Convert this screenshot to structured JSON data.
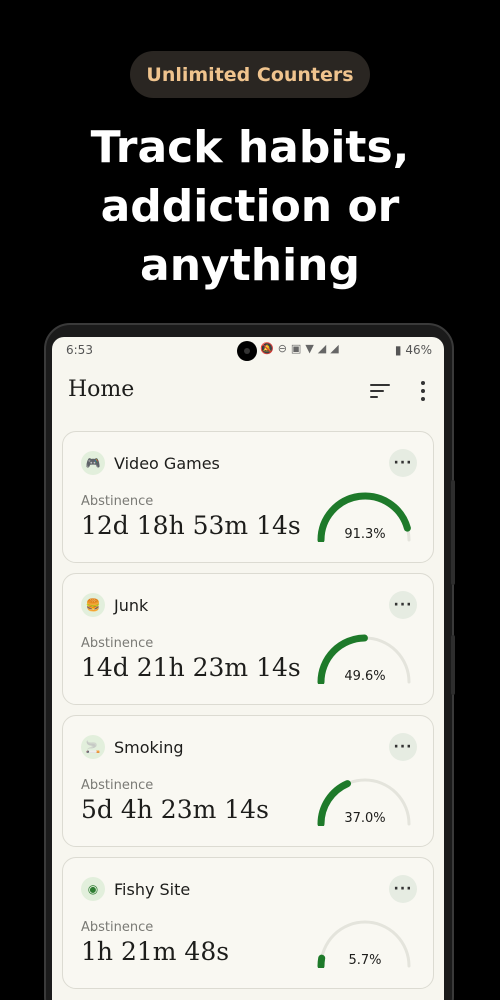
{
  "promo": {
    "badge": "Unlimited Counters",
    "headline_lines": [
      "Track habits,",
      "addiction or",
      "anything"
    ]
  },
  "status_bar": {
    "time": "6:53",
    "battery": "46%"
  },
  "app": {
    "title": "Home"
  },
  "counters": [
    {
      "name": "Video Games",
      "icon": "gamepad-icon",
      "icon_glyph": "🎮",
      "label": "Abstinence",
      "timer": "12d 18h 53m 14s",
      "percent": 91.3,
      "percent_text": "91.3%"
    },
    {
      "name": "Junk",
      "icon": "fast-food-icon",
      "icon_glyph": "🍔",
      "label": "Abstinence",
      "timer": "14d 21h 23m 14s",
      "percent": 49.6,
      "percent_text": "49.6%"
    },
    {
      "name": "Smoking",
      "icon": "cigarette-icon",
      "icon_glyph": "🚬",
      "label": "Abstinence",
      "timer": "5d 4h 23m 14s",
      "percent": 37.0,
      "percent_text": "37.0%"
    },
    {
      "name": "Fishy Site",
      "icon": "eye-icon",
      "icon_glyph": "◉",
      "label": "Abstinence",
      "timer": "1h 21m 48s",
      "percent": 5.7,
      "percent_text": "5.7%"
    }
  ],
  "colors": {
    "accent": "#1e7a2a",
    "track": "#e4e4dc",
    "badge_text": "#f0c48e",
    "screen_bg": "#f7f6ef"
  }
}
